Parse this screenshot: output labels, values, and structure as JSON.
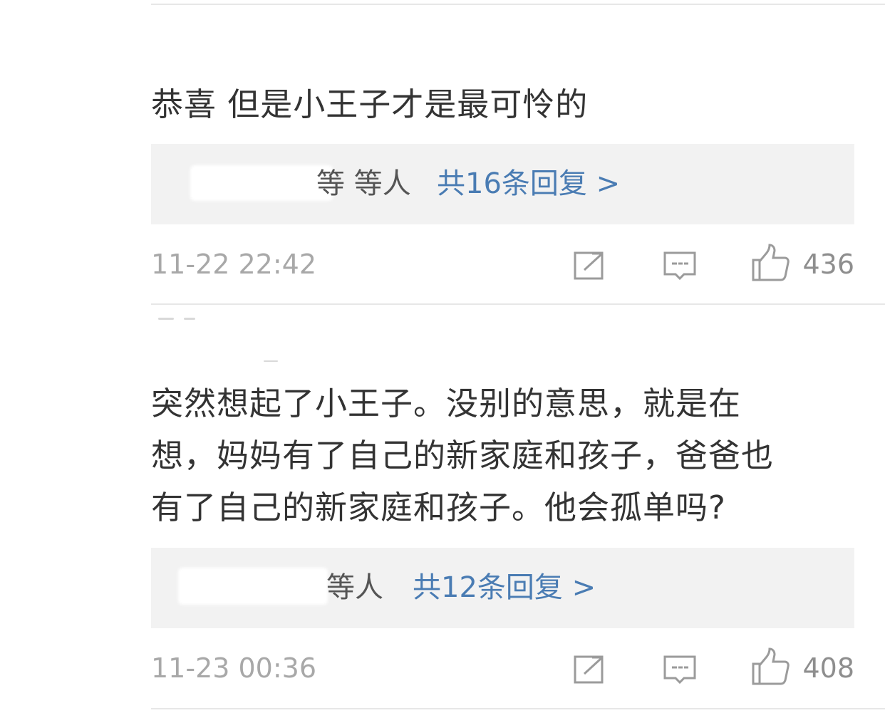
{
  "comments": [
    {
      "text_lines": [
        "恭喜 但是小王子才是最可怜的"
      ],
      "reply_names_fragment": "等 等人",
      "reply_link": "共16条回复 >",
      "timestamp": "11-22 22:42",
      "likes": "436"
    },
    {
      "text_lines": [
        "突然想起了小王子。没别的意思，就是在",
        "想，妈妈有了自己的新家庭和孩子，爸爸也",
        "有了自己的新家庭和孩子。他会孤单吗?"
      ],
      "reply_names_fragment": "等人",
      "reply_link": "共12条回复 >",
      "timestamp": "11-23 00:36",
      "likes": "408"
    }
  ],
  "icons": {
    "share": "share-icon",
    "comment": "comment-icon",
    "like": "thumbs-up-icon"
  },
  "colors": {
    "link": "#4a7cb3",
    "reply_bg": "#f2f2f2",
    "meta_text": "#a8a8a8",
    "icon": "#9b9b9b"
  }
}
